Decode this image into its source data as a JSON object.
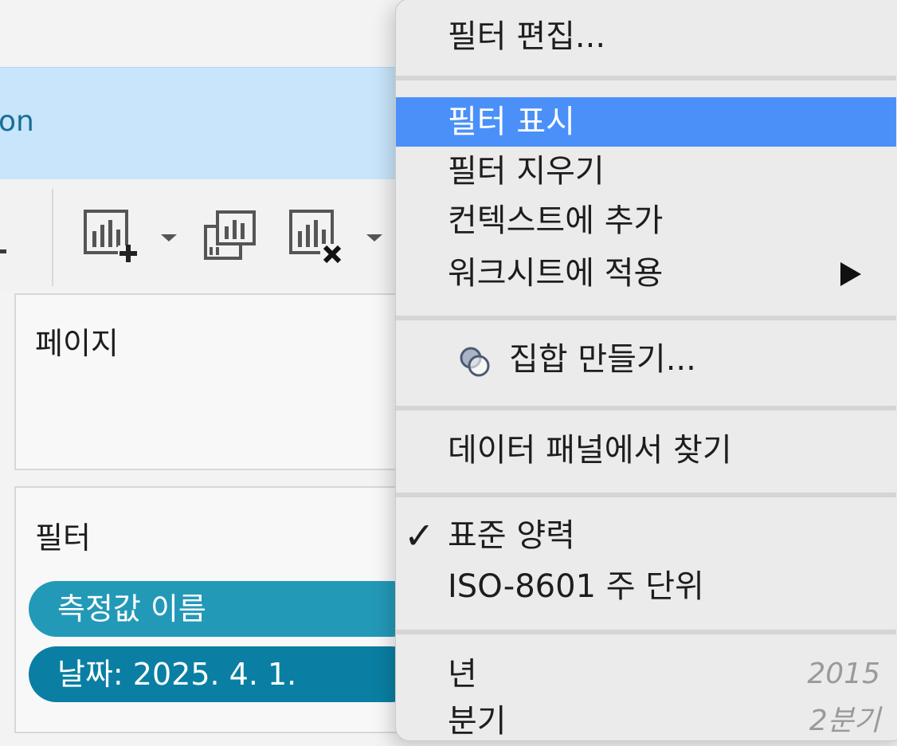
{
  "banner": {
    "text": "on"
  },
  "toolbar": {
    "icons": [
      "add-chart-icon",
      "duplicate-chart-icon",
      "clear-chart-icon"
    ]
  },
  "cards": {
    "pages_title": "페이지",
    "filters_title": "필터",
    "filter_pills": [
      {
        "label": "측정값 이름",
        "color": "#2399b8"
      },
      {
        "label": "날짜: 2025. 4. 1.",
        "color": "#0a7fa3"
      }
    ]
  },
  "menu": {
    "edit_filter": "필터 편집...",
    "show_filter": "필터 표시",
    "clear_filter": "필터 지우기",
    "add_to_context": "컨텍스트에 추가",
    "apply_to_worksheets": "워크시트에 적용",
    "create_set": "집합 만들기...",
    "find_in_data_pane": "데이터 패널에서 찾기",
    "standard_calendar": "표준 양력",
    "iso_week": "ISO-8601 주 단위",
    "year": "년",
    "year_value": "2015",
    "quarter": "분기",
    "quarter_value": "2분기",
    "highlight_color": "#4a90f8"
  }
}
